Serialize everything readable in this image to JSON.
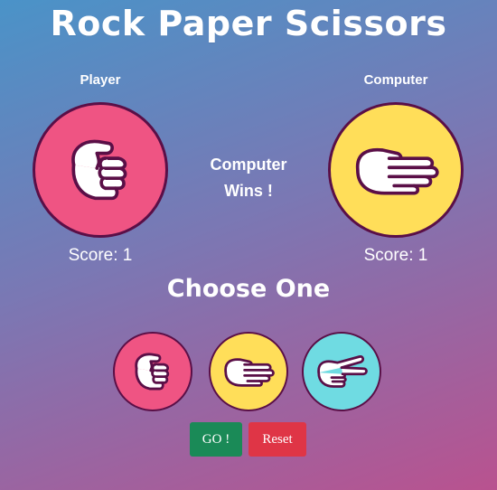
{
  "title": "Rock Paper Scissors",
  "player": {
    "label": "Player",
    "score_text": "Score: 1",
    "hand": "fist-icon",
    "circle_color": "#ef5483"
  },
  "computer": {
    "label": "Computer",
    "score_text": "Score: 1",
    "hand": "open-hand-icon",
    "circle_color": "#ffde59"
  },
  "result": {
    "line1": "Computer",
    "line2": "Wins !"
  },
  "choose_heading": "Choose One",
  "choices": [
    {
      "name": "rock",
      "icon": "fist-icon",
      "color": "#ef5483"
    },
    {
      "name": "paper",
      "icon": "open-hand-icon",
      "color": "#ffde59"
    },
    {
      "name": "scissors",
      "icon": "scissors-hand-icon",
      "color": "#6fdbe2"
    }
  ],
  "buttons": {
    "go_label": "GO !",
    "go_color": "#1a8a57",
    "reset_label": "Reset",
    "reset_color": "#df3546"
  },
  "colors": {
    "outline": "#5a0f47",
    "hand_fill": "#ffffff"
  }
}
